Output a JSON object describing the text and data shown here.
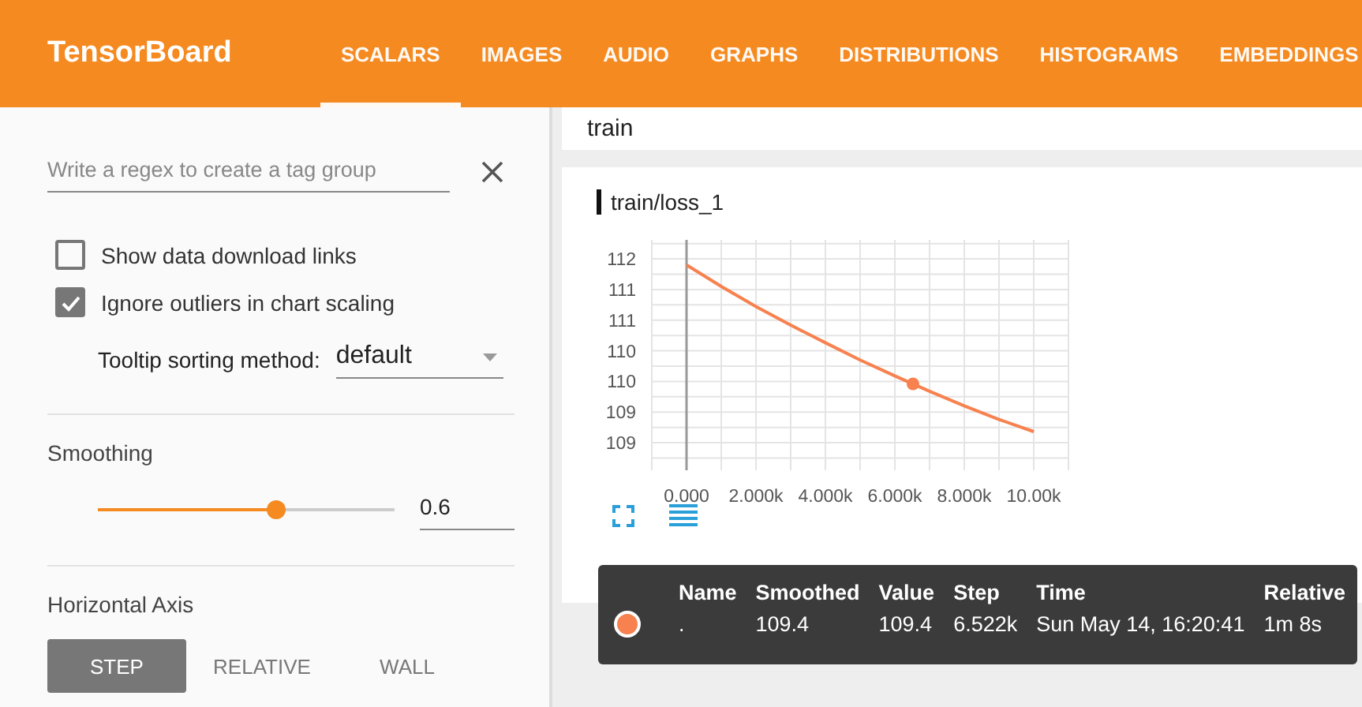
{
  "header": {
    "title": "TensorBoard",
    "tabs": [
      {
        "label": "SCALARS",
        "selected": true
      },
      {
        "label": "IMAGES",
        "selected": false
      },
      {
        "label": "AUDIO",
        "selected": false
      },
      {
        "label": "GRAPHS",
        "selected": false
      },
      {
        "label": "DISTRIBUTIONS",
        "selected": false
      },
      {
        "label": "HISTOGRAMS",
        "selected": false
      },
      {
        "label": "EMBEDDINGS",
        "selected": false
      }
    ]
  },
  "sidebar": {
    "regex": {
      "placeholder": "Write a regex to create a tag group"
    },
    "checkboxes": [
      {
        "label": "Show data download links",
        "checked": false
      },
      {
        "label": "Ignore outliers in chart scaling",
        "checked": true
      }
    ],
    "tooltip_sorting": {
      "label": "Tooltip sorting method:",
      "value": "default"
    },
    "smoothing": {
      "label": "Smoothing",
      "level": 0.6,
      "value": "0.6"
    },
    "horizontal_axis": {
      "label": "Horizontal Axis",
      "options": [
        {
          "label": "STEP",
          "selected": true
        },
        {
          "label": "RELATIVE",
          "selected": false
        },
        {
          "label": "WALL",
          "selected": false
        }
      ]
    }
  },
  "main": {
    "group": "train",
    "chart": {
      "title": "train/loss_1",
      "chart_data": {
        "type": "line",
        "x": [
          0,
          1000,
          2000,
          3000,
          4000,
          5000,
          6000,
          6522,
          7000,
          8000,
          9000,
          10000
        ],
        "grid": true,
        "series": [
          {
            "color": "#f7814f",
            "values": [
              111.9,
              111.55,
              111.22,
              110.92,
              110.63,
              110.35,
              110.09,
              109.96,
              109.84,
              109.6,
              109.38,
              109.18
            ]
          },
          {
            "color": "#f7814f",
            "marker": "circle",
            "values": [
              null,
              null,
              null,
              null,
              null,
              null,
              null,
              109.96,
              null,
              null,
              null,
              null
            ]
          }
        ],
        "xlim": [
          -1000,
          11000
        ],
        "ylim": [
          108.55,
          112.31
        ],
        "xticks": [
          {
            "value": 0,
            "label": "0.000"
          },
          {
            "value": 2000,
            "label": "2.000k"
          },
          {
            "value": 4000,
            "label": "4.000k"
          },
          {
            "value": 6000,
            "label": "6.000k"
          },
          {
            "value": 8000,
            "label": "8.000k"
          },
          {
            "value": 10000,
            "label": "10.00k"
          }
        ],
        "yticks": [
          {
            "value": 112,
            "label": "112"
          },
          {
            "value": 111.5,
            "label": "111"
          },
          {
            "value": 111,
            "label": "111"
          },
          {
            "value": 110.5,
            "label": "110"
          },
          {
            "value": 110,
            "label": "110"
          },
          {
            "value": 109.5,
            "label": "109"
          },
          {
            "value": 109,
            "label": "109"
          }
        ]
      }
    },
    "tooltip": {
      "columns": [
        "Name",
        "Smoothed",
        "Value",
        "Step",
        "Time",
        "Relative"
      ],
      "rows": [
        {
          "color": "#f7814f",
          "cells": [
            ".",
            "109.4",
            "109.4",
            "6.522k",
            "Sun May 14, 16:20:41",
            "1m 8s"
          ]
        }
      ]
    }
  }
}
